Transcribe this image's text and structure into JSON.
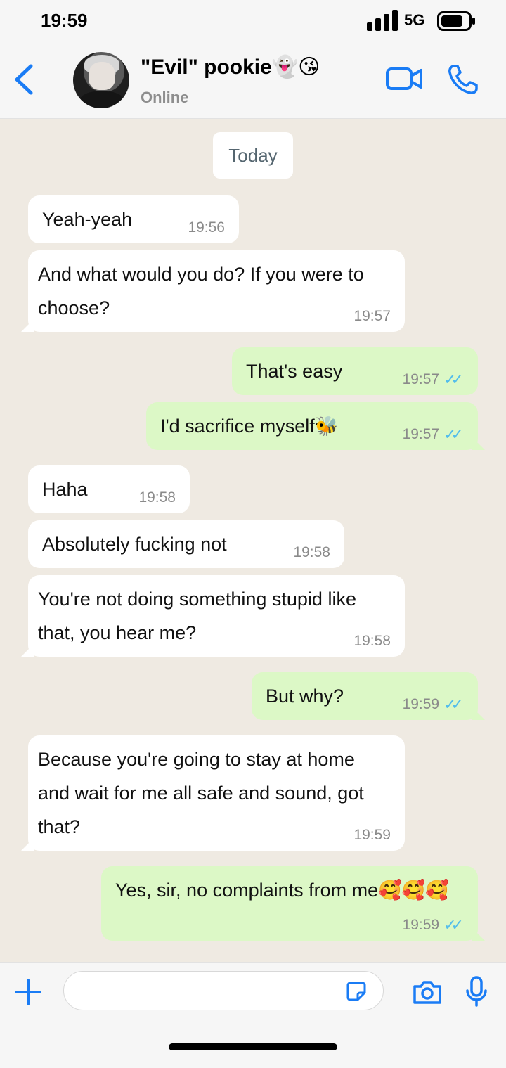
{
  "status_bar": {
    "time": "19:59",
    "network": "5G"
  },
  "contact": {
    "name": "\"Evil\" pookie👻😘",
    "status": "Online"
  },
  "date_separator": "Today",
  "messages": [
    {
      "dir": "in",
      "text": "Yeah-yeah",
      "time": "19:56"
    },
    {
      "dir": "in",
      "text": "And what would you do? If you were to choose?",
      "time": "19:57"
    },
    {
      "dir": "out",
      "text": "That's easy",
      "time": "19:57",
      "read": true
    },
    {
      "dir": "out",
      "text": "I'd sacrifice myself🐝",
      "time": "19:57",
      "read": true
    },
    {
      "dir": "in",
      "text": "Haha",
      "time": "19:58"
    },
    {
      "dir": "in",
      "text": "Absolutely fucking not",
      "time": "19:58"
    },
    {
      "dir": "in",
      "text": "You're not doing something stupid like that, you hear me?",
      "time": "19:58"
    },
    {
      "dir": "out",
      "text": "But why?",
      "time": "19:59",
      "read": true
    },
    {
      "dir": "in",
      "text": "Because you're going to stay at home and wait for me all safe and sound, got that?",
      "time": "19:59"
    },
    {
      "dir": "out",
      "text": "Yes, sir, no complaints from me🥰🥰🥰",
      "time": "19:59",
      "read": true
    }
  ],
  "composer": {
    "placeholder": ""
  },
  "icons": {
    "back": "chevron-left-icon",
    "video": "video-camera-icon",
    "call": "phone-icon",
    "add": "plus-icon",
    "sticker": "sticker-icon",
    "camera": "camera-icon",
    "mic": "microphone-icon"
  },
  "colors": {
    "accent": "#1a7cf5",
    "incoming_bubble": "#ffffff",
    "outgoing_bubble": "#dcf8c6",
    "read_tick": "#53bdeb",
    "chat_background": "#efeae2"
  }
}
